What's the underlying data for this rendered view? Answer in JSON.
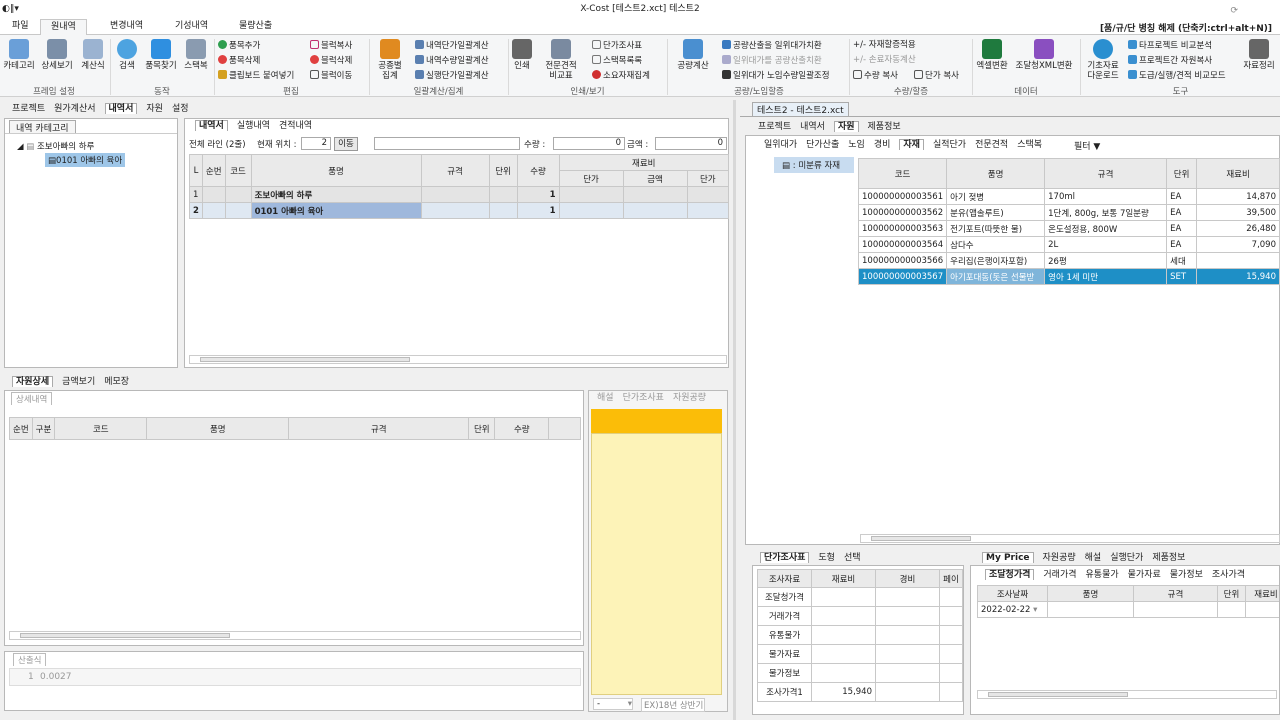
{
  "window": {
    "title": "X-Cost [테스트2.xct] 테스트2",
    "right_hint": "[품/규/단 병칭 해제 (단축키:ctrl+alt+N)]"
  },
  "menu_tabs": [
    "파일",
    "원내역",
    "변경내역",
    "기성내역",
    "물량산출"
  ],
  "ribbon": {
    "frame": {
      "buttons": [
        "카테고리",
        "상세보기",
        "계산식"
      ],
      "label": "프레임 설정"
    },
    "action": {
      "buttons": [
        "검색",
        "품목찾기",
        "스택복"
      ],
      "label": "동작"
    },
    "edit": {
      "items": [
        "품목추가",
        "품목삭제",
        "클립보드 붙여넣기",
        "블럭복사",
        "블럭삭제",
        "블럭이동"
      ],
      "label": "편집"
    },
    "batch": {
      "big": "공종별\n집계",
      "items": [
        "내역단가일괄계산",
        "내역수량일괄계산",
        "실행단가일괄계산"
      ],
      "label": "일괄계산/집계"
    },
    "print": {
      "big1": "인쇄",
      "big2": "전문견적\n비교표",
      "items": [
        "단가조사표",
        "스택목록록",
        "소요자재집계"
      ],
      "label": "인쇄/보기"
    },
    "labor": {
      "big": "공량계산",
      "items": [
        "공량산출을 일위대가치환",
        "일위대가를 공량산출치환",
        "일위대가 노임수량일괄조정"
      ],
      "label": "공량/노임할증"
    },
    "qty": {
      "items": [
        "+/- 자재할증적용",
        "+/- 손료자동계산",
        "수량 복사",
        "단가 복사"
      ],
      "label": "수량/할증"
    },
    "data": {
      "buttons": [
        "엑셀변환",
        "조달청XML변환"
      ],
      "label": "데이터"
    },
    "tools": {
      "big": "기초자료\n다운로드",
      "items": [
        "타프로젝트 비교분석",
        "프로젝트간 자원복사",
        "도급/실행/견적 비교모드"
      ],
      "extra": "자료정리",
      "label": "도구"
    }
  },
  "left": {
    "top_tabs": [
      "프로젝트",
      "원가계산서",
      "내역서",
      "자원",
      "설정"
    ],
    "category_title": "내역 카테고리",
    "tree": [
      "조보아빠의 하루",
      "0101 아빠의 육아"
    ],
    "detail_tabs": [
      "내역서",
      "실행내역",
      "견적내역"
    ],
    "info": {
      "total": "전체 라인 (2줄)",
      "pos_label": "현재 위치 :",
      "pos": "2",
      "move": "이동",
      "qty_label": "수량 :",
      "qty": "0",
      "amt_label": "금액 :",
      "amt": "0"
    },
    "grid_head": [
      "L",
      "순번",
      "코드",
      "품명",
      "규격",
      "단위",
      "수량",
      "재료비",
      "단가",
      "금액",
      "단가"
    ],
    "rows": [
      {
        "l": "1",
        "name": "조보아빠의 하루",
        "qty": "1"
      },
      {
        "l": "2",
        "name": "0101 아빠의 육아",
        "qty": "1"
      }
    ],
    "bottom_tabs": [
      "자원상세",
      "금액보기",
      "메모장"
    ],
    "sub_title": "상세내역",
    "sub_head": [
      "순번",
      "구분",
      "코드",
      "품명",
      "규격",
      "단위",
      "수량"
    ],
    "calc_title": "산출식",
    "calc_line": "1",
    "calc_val": "0.0027",
    "side_tabs": [
      "해설",
      "단가조사표",
      "자원공량"
    ],
    "side_select": "-",
    "side_period": "EX)18년 상반기"
  },
  "right": {
    "title_tab": "테스트2 - 테스트2.xct",
    "top_tabs": [
      "프로젝트",
      "내역서",
      "자원",
      "제품정보"
    ],
    "res_tabs": [
      "일위대가",
      "단가산출",
      "노임",
      "경비",
      "자재",
      "실적단가",
      "전문견적",
      "스택복"
    ],
    "filter": "필터 ▼",
    "tree_item": "미분류 자재",
    "head": [
      "코드",
      "품명",
      "규격",
      "단위",
      "재료비"
    ],
    "rows": [
      [
        "100000000003561",
        "아기 젖병",
        "170ml",
        "EA",
        "14,870"
      ],
      [
        "100000000003562",
        "분유(앱솔루트)",
        "1단계, 800g, 보통 7일분량",
        "EA",
        "39,500"
      ],
      [
        "100000000003563",
        "전기포트(따뜻한 물)",
        "온도설정용, 800W",
        "EA",
        "26,480"
      ],
      [
        "100000000003564",
        "삼다수",
        "2L",
        "EA",
        "7,090"
      ],
      [
        "100000000003566",
        "우리집(은행이자포함)",
        "26평",
        "세대",
        ""
      ],
      [
        "100000000003567",
        "아기포대동(돗은 선물받",
        "영아 1세 미만",
        "SET",
        "15,940"
      ]
    ],
    "price_tabs": [
      "단가조사표",
      "도형",
      "선택"
    ],
    "price_head": [
      "조사자료",
      "재료비",
      "경비",
      "페이"
    ],
    "price_rows": [
      "조달청가격",
      "거래가격",
      "유통물가",
      "물가자료",
      "물가정보",
      "조사가격1"
    ],
    "price_val": "15,940",
    "my_tabs": [
      "My Price",
      "자원공량",
      "해설",
      "실행단가",
      "제품정보"
    ],
    "my_sub": [
      "조달청가격",
      "거래가격",
      "유통물가",
      "물가자료",
      "물가정보",
      "조사가격"
    ],
    "my_head": [
      "조사날짜",
      "품명",
      "규격",
      "단위",
      "재료비"
    ],
    "my_date": "2022-02-22"
  },
  "colors": {
    "selection": "#1e8fc6",
    "memo": "#fdf3b8",
    "memo_bar": "#fbbd08"
  }
}
